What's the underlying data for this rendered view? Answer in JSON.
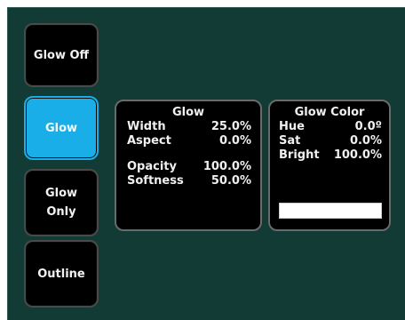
{
  "modes": {
    "glow_off": "Glow Off",
    "glow": "Glow",
    "glow_only_line1": "Glow",
    "glow_only_line2": "Only",
    "outline": "Outline"
  },
  "glow_box": {
    "title": "Glow",
    "width_label": "Width",
    "width_value": "25.0%",
    "aspect_label": "Aspect",
    "aspect_value": "0.0%",
    "opacity_label": "Opacity",
    "opacity_value": "100.0%",
    "softness_label": "Softness",
    "softness_value": "50.0%"
  },
  "glow_color_box": {
    "title": "Glow Color",
    "hue_label": "Hue",
    "hue_value": "0.0º",
    "sat_label": "Sat",
    "sat_value": "0.0%",
    "bright_label": "Bright",
    "bright_value": "100.0%",
    "swatch_color": "#ffffff"
  },
  "colors": {
    "panel_bg": "#133b35",
    "active_button": "#1aaee8",
    "button_bg": "#000000"
  }
}
